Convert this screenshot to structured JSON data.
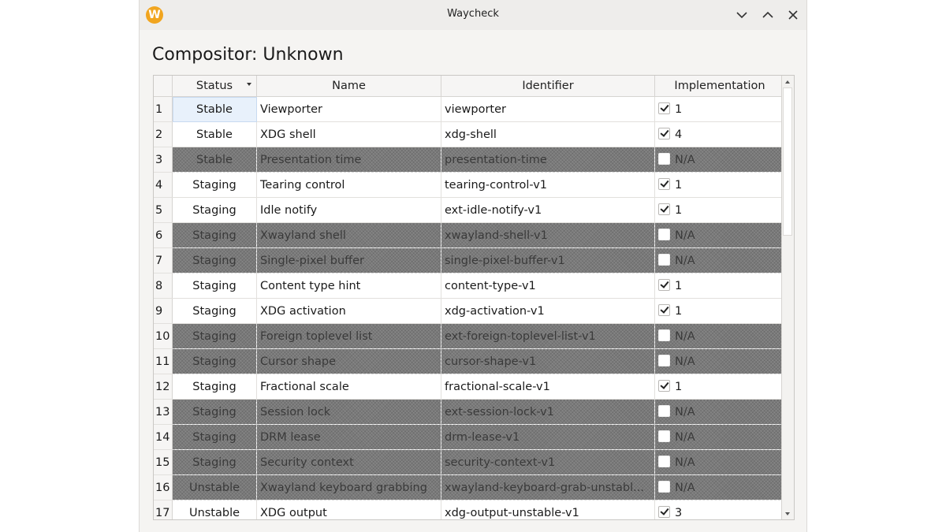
{
  "window": {
    "title": "Waycheck",
    "app_icon_letter": "W",
    "buttons": {
      "minimize": "minimize",
      "maximize": "maximize",
      "close": "close"
    }
  },
  "compositor_label": "Compositor: Unknown",
  "table": {
    "headers": {
      "status": "Status",
      "name": "Name",
      "identifier": "Identifier",
      "implementation": "Implementation"
    },
    "sort_column": "status",
    "rows": [
      {
        "num": "1",
        "status": "Stable",
        "name": "Viewporter",
        "identifier": "viewporter",
        "supported": true,
        "impl": "1"
      },
      {
        "num": "2",
        "status": "Stable",
        "name": "XDG shell",
        "identifier": "xdg-shell",
        "supported": true,
        "impl": "4"
      },
      {
        "num": "3",
        "status": "Stable",
        "name": "Presentation time",
        "identifier": "presentation-time",
        "supported": false,
        "impl": "N/A"
      },
      {
        "num": "4",
        "status": "Staging",
        "name": "Tearing control",
        "identifier": "tearing-control-v1",
        "supported": true,
        "impl": "1"
      },
      {
        "num": "5",
        "status": "Staging",
        "name": "Idle notify",
        "identifier": "ext-idle-notify-v1",
        "supported": true,
        "impl": "1"
      },
      {
        "num": "6",
        "status": "Staging",
        "name": "Xwayland shell",
        "identifier": "xwayland-shell-v1",
        "supported": false,
        "impl": "N/A"
      },
      {
        "num": "7",
        "status": "Staging",
        "name": "Single-pixel buffer",
        "identifier": "single-pixel-buffer-v1",
        "supported": false,
        "impl": "N/A"
      },
      {
        "num": "8",
        "status": "Staging",
        "name": "Content type hint",
        "identifier": "content-type-v1",
        "supported": true,
        "impl": "1"
      },
      {
        "num": "9",
        "status": "Staging",
        "name": "XDG activation",
        "identifier": "xdg-activation-v1",
        "supported": true,
        "impl": "1"
      },
      {
        "num": "10",
        "status": "Staging",
        "name": "Foreign toplevel list",
        "identifier": "ext-foreign-toplevel-list-v1",
        "supported": false,
        "impl": "N/A"
      },
      {
        "num": "11",
        "status": "Staging",
        "name": "Cursor shape",
        "identifier": "cursor-shape-v1",
        "supported": false,
        "impl": "N/A"
      },
      {
        "num": "12",
        "status": "Staging",
        "name": "Fractional scale",
        "identifier": "fractional-scale-v1",
        "supported": true,
        "impl": "1"
      },
      {
        "num": "13",
        "status": "Staging",
        "name": "Session lock",
        "identifier": "ext-session-lock-v1",
        "supported": false,
        "impl": "N/A"
      },
      {
        "num": "14",
        "status": "Staging",
        "name": "DRM lease",
        "identifier": "drm-lease-v1",
        "supported": false,
        "impl": "N/A"
      },
      {
        "num": "15",
        "status": "Staging",
        "name": "Security context",
        "identifier": "security-context-v1",
        "supported": false,
        "impl": "N/A"
      },
      {
        "num": "16",
        "status": "Unstable",
        "name": "Xwayland keyboard grabbing",
        "identifier": "xwayland-keyboard-grab-unstabl...",
        "supported": false,
        "impl": "N/A"
      },
      {
        "num": "17",
        "status": "Unstable",
        "name": "XDG output",
        "identifier": "xdg-output-unstable-v1",
        "supported": true,
        "impl": "3"
      }
    ]
  },
  "colors": {
    "unsupported_row": "#7a7a7a",
    "selection": "#e8f1fb",
    "app_icon": "#f1a51f"
  }
}
